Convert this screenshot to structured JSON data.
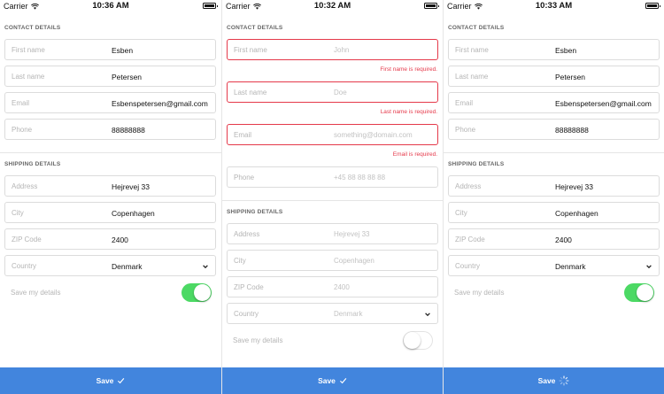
{
  "colors": {
    "accent": "#4285dd",
    "error": "#e5394a",
    "toggle_on": "#4cd964"
  },
  "panels": [
    {
      "status": {
        "carrier": "Carrier",
        "time": "10:36 AM"
      },
      "contact_title": "CONTACT DETAILS",
      "contact": [
        {
          "label": "First name",
          "value": "Esben"
        },
        {
          "label": "Last name",
          "value": "Petersen"
        },
        {
          "label": "Email",
          "value": "Esbenspetersen@gmail.com"
        },
        {
          "label": "Phone",
          "value": "88888888"
        }
      ],
      "shipping_title": "SHIPPING DETAILS",
      "shipping": [
        {
          "label": "Address",
          "value": "Hejrevej 33"
        },
        {
          "label": "City",
          "value": "Copenhagen"
        },
        {
          "label": "ZIP Code",
          "value": "2400"
        },
        {
          "label": "Country",
          "value": "Denmark"
        }
      ],
      "save_details_label": "Save my details",
      "save_details_on": true,
      "save_button": {
        "label": "Save",
        "icon": "checkmark-icon"
      }
    },
    {
      "status": {
        "carrier": "Carrier",
        "time": "10:32 AM"
      },
      "contact_title": "CONTACT DETAILS",
      "contact": [
        {
          "label": "First name",
          "placeholder": "John",
          "error": "First name is required."
        },
        {
          "label": "Last name",
          "placeholder": "Doe",
          "error": "Last name is required."
        },
        {
          "label": "Email",
          "placeholder": "something@domain.com",
          "error": "Email is required."
        },
        {
          "label": "Phone",
          "placeholder": "+45 88 88 88 88"
        }
      ],
      "shipping_title": "SHIPPING DETAILS",
      "shipping": [
        {
          "label": "Address",
          "placeholder": "Hejrevej 33"
        },
        {
          "label": "City",
          "placeholder": "Copenhagen"
        },
        {
          "label": "ZIP Code",
          "placeholder": "2400"
        },
        {
          "label": "Country",
          "placeholder": "Denmark"
        }
      ],
      "save_details_label": "Save my details",
      "save_details_on": false,
      "save_button": {
        "label": "Save",
        "icon": "checkmark-icon"
      }
    },
    {
      "status": {
        "carrier": "Carrier",
        "time": "10:33 AM"
      },
      "contact_title": "CONTACT DETAILS",
      "contact": [
        {
          "label": "First name",
          "value": "Esben"
        },
        {
          "label": "Last name",
          "value": "Petersen"
        },
        {
          "label": "Email",
          "value": "Esbenspetersen@gmail.com"
        },
        {
          "label": "Phone",
          "value": "88888888"
        }
      ],
      "shipping_title": "SHIPPING DETAILS",
      "shipping": [
        {
          "label": "Address",
          "value": "Hejrevej 33"
        },
        {
          "label": "City",
          "value": "Copenhagen"
        },
        {
          "label": "ZIP Code",
          "value": "2400"
        },
        {
          "label": "Country",
          "value": "Denmark"
        }
      ],
      "save_details_label": "Save my details",
      "save_details_on": true,
      "save_button": {
        "label": "Save",
        "icon": "spinner-icon"
      }
    }
  ]
}
